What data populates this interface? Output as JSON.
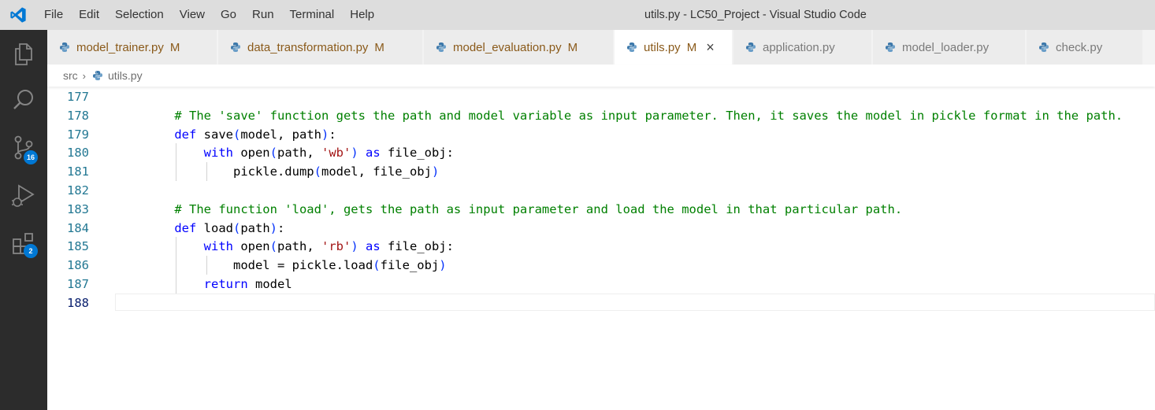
{
  "titlebar": {
    "menu": [
      "File",
      "Edit",
      "Selection",
      "View",
      "Go",
      "Run",
      "Terminal",
      "Help"
    ],
    "window_title": "utils.py - LC50_Project - Visual Studio Code"
  },
  "activity_bar": {
    "items": [
      {
        "name": "explorer",
        "icon": "files-icon"
      },
      {
        "name": "search",
        "icon": "search-icon"
      },
      {
        "name": "source-control",
        "icon": "source-control-icon",
        "badge": "16"
      },
      {
        "name": "run-debug",
        "icon": "run-debug-icon"
      },
      {
        "name": "extensions",
        "icon": "extensions-icon",
        "badge": "2"
      }
    ]
  },
  "tabs": [
    {
      "label": "model_trainer.py",
      "modified": "M",
      "active": false
    },
    {
      "label": "data_transformation.py",
      "modified": "M",
      "active": false
    },
    {
      "label": "model_evaluation.py",
      "modified": "M",
      "active": false
    },
    {
      "label": "utils.py",
      "modified": "M",
      "active": true,
      "close": "×"
    },
    {
      "label": "application.py",
      "modified": "",
      "active": false
    },
    {
      "label": "model_loader.py",
      "modified": "",
      "active": false
    },
    {
      "label": "check.py",
      "modified": "",
      "active": false
    }
  ],
  "breadcrumb": {
    "folder": "src",
    "separator": "›",
    "file": "utils.py"
  },
  "editor": {
    "current_line": "188",
    "lines": [
      {
        "n": "177",
        "tokens": []
      },
      {
        "n": "178",
        "tokens": [
          {
            "t": "    "
          },
          {
            "t": "# The 'save' function gets the path and model variable as input parameter. Then, it saves the model in pickle format in the path.",
            "c": "c"
          }
        ]
      },
      {
        "n": "179",
        "tokens": [
          {
            "t": "    "
          },
          {
            "t": "def",
            "c": "k"
          },
          {
            "t": " save"
          },
          {
            "t": "(",
            "c": "p1"
          },
          {
            "t": "model, path"
          },
          {
            "t": ")",
            "c": "p1"
          },
          {
            "t": ":"
          }
        ]
      },
      {
        "n": "180",
        "tokens": [
          {
            "t": "        "
          },
          {
            "t": "with",
            "c": "k"
          },
          {
            "t": " open"
          },
          {
            "t": "(",
            "c": "p1"
          },
          {
            "t": "path, "
          },
          {
            "t": "'wb'",
            "c": "s"
          },
          {
            "t": ")",
            "c": "p1"
          },
          {
            "t": " "
          },
          {
            "t": "as",
            "c": "k"
          },
          {
            "t": " file_obj:"
          }
        ]
      },
      {
        "n": "181",
        "tokens": [
          {
            "t": "            "
          },
          {
            "t": "pickle.dump"
          },
          {
            "t": "(",
            "c": "p1"
          },
          {
            "t": "model, file_obj"
          },
          {
            "t": ")",
            "c": "p1"
          }
        ]
      },
      {
        "n": "182",
        "tokens": []
      },
      {
        "n": "183",
        "tokens": [
          {
            "t": "    "
          },
          {
            "t": "# The function 'load', gets the path as input parameter and load the model in that particular path.",
            "c": "c"
          }
        ]
      },
      {
        "n": "184",
        "tokens": [
          {
            "t": "    "
          },
          {
            "t": "def",
            "c": "k"
          },
          {
            "t": " load"
          },
          {
            "t": "(",
            "c": "p1"
          },
          {
            "t": "path"
          },
          {
            "t": ")",
            "c": "p1"
          },
          {
            "t": ":"
          }
        ]
      },
      {
        "n": "185",
        "tokens": [
          {
            "t": "        "
          },
          {
            "t": "with",
            "c": "k"
          },
          {
            "t": " open"
          },
          {
            "t": "(",
            "c": "p1"
          },
          {
            "t": "path, "
          },
          {
            "t": "'rb'",
            "c": "s"
          },
          {
            "t": ")",
            "c": "p1"
          },
          {
            "t": " "
          },
          {
            "t": "as",
            "c": "k"
          },
          {
            "t": " file_obj:"
          }
        ]
      },
      {
        "n": "186",
        "tokens": [
          {
            "t": "            "
          },
          {
            "t": "model = pickle.load"
          },
          {
            "t": "(",
            "c": "p1"
          },
          {
            "t": "file_obj"
          },
          {
            "t": ")",
            "c": "p1"
          }
        ]
      },
      {
        "n": "187",
        "tokens": [
          {
            "t": "        "
          },
          {
            "t": "return",
            "c": "k"
          },
          {
            "t": " model"
          }
        ]
      },
      {
        "n": "188",
        "tokens": []
      }
    ]
  }
}
